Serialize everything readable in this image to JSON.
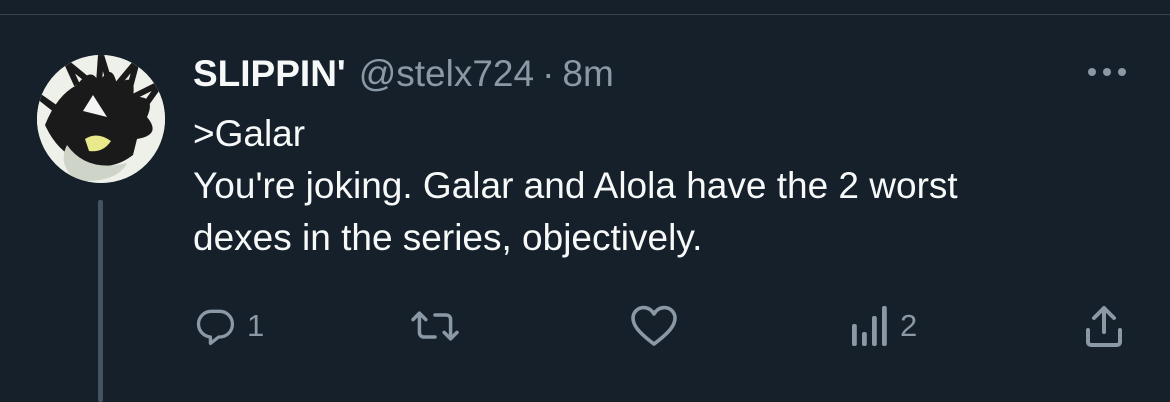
{
  "tweet": {
    "display_name": "SLIPPIN'",
    "handle": "@stelx724",
    "separator": "·",
    "time": "8m",
    "text_lines": [
      ">Galar",
      "You're joking. Galar and Alola have the 2 worst",
      "dexes in the series, objectively."
    ]
  },
  "actions": {
    "reply_count": "1",
    "retweet_count": "",
    "like_count": "",
    "views_count": "2"
  },
  "icons": {
    "more": "more-horizontal-icon",
    "reply": "reply-icon",
    "retweet": "retweet-icon",
    "like": "heart-icon",
    "views": "analytics-icon",
    "share": "share-icon"
  },
  "colors": {
    "background": "#15202b",
    "primary_text": "#f7f9f9",
    "secondary_text": "#8b98a5",
    "thread_line": "#425364"
  }
}
